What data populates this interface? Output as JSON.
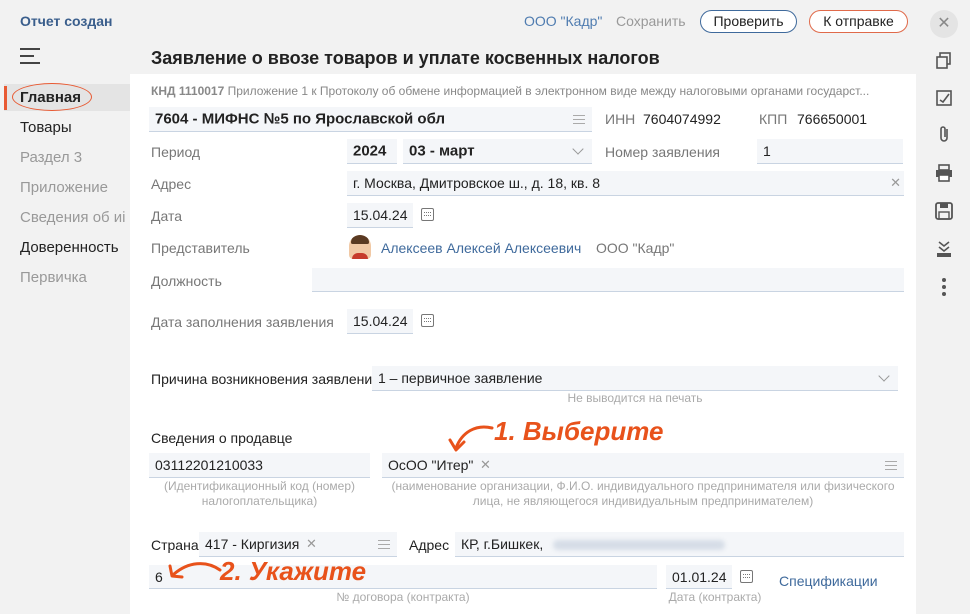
{
  "header": {
    "status": "Отчет создан",
    "org": "ООО \"Кадр\"",
    "save": "Сохранить",
    "check": "Проверить",
    "send": "К отправке"
  },
  "title": "Заявление о ввозе товаров и уплате косвенных налогов",
  "sidebar": {
    "items": [
      {
        "label": "Главная"
      },
      {
        "label": "Товары"
      },
      {
        "label": "Раздел 3"
      },
      {
        "label": "Приложение"
      },
      {
        "label": "Сведения об иі"
      },
      {
        "label": "Доверенность"
      },
      {
        "label": "Первичка"
      }
    ]
  },
  "form": {
    "knd_code": "КНД 1110017",
    "knd_text": "Приложение 1 к Протоколу об обмене информацией в электронном виде между налоговыми органами государст...",
    "tax_office": "7604 - МИФНС №5 по Ярославской обл",
    "inn_label": "ИНН",
    "inn": "7604074992",
    "kpp_label": "КПП",
    "kpp": "766650001",
    "period_label": "Период",
    "period_year": "2024",
    "period_month": "03 - март",
    "number_label": "Номер заявления",
    "number": "1",
    "address_label": "Адрес",
    "address": "г. Москва, Дмитровское ш., д. 18, кв. 8",
    "date_label": "Дата",
    "date": "15.04.24",
    "rep_label": "Представитель",
    "rep_name": "Алексеев Алексей Алексеевич",
    "rep_org": "ООО \"Кадр\"",
    "position_label": "Должность",
    "position": "",
    "fill_date_label": "Дата заполнения заявления",
    "fill_date": "15.04.24",
    "reason_label": "Причина возникновения заявления",
    "reason": "1 – первичное заявление",
    "reason_hint": "Не выводится на печать",
    "seller_label": "Сведения о продавце",
    "seller_code": "03112201210033",
    "seller_code_hint": "(Идентификационный код (номер) налогоплательщика)",
    "seller_name": "ОсОО \"Итер\"",
    "seller_name_hint": "(наименование организации, Ф.И.О. индивидуального предпринимателя или физического лица, не являющегося индивидуальным предпринимателем)",
    "country_label": "Страна",
    "country": "417 - Киргизия",
    "seller_addr_label": "Адрес",
    "seller_addr": "КР, г.Бишкек,",
    "contract_num": "6",
    "contract_num_hint": "№ договора (контракта)",
    "contract_date": "01.01.24",
    "contract_date_hint": "Дата (контракта)",
    "specs_link": "Спецификации"
  },
  "annotations": {
    "step1": "1. Выберите",
    "step2": "2. Укажите"
  },
  "colors": {
    "accent": "#e85a33",
    "link": "#3f6a9c",
    "field_bg": "#f4f6f9"
  }
}
